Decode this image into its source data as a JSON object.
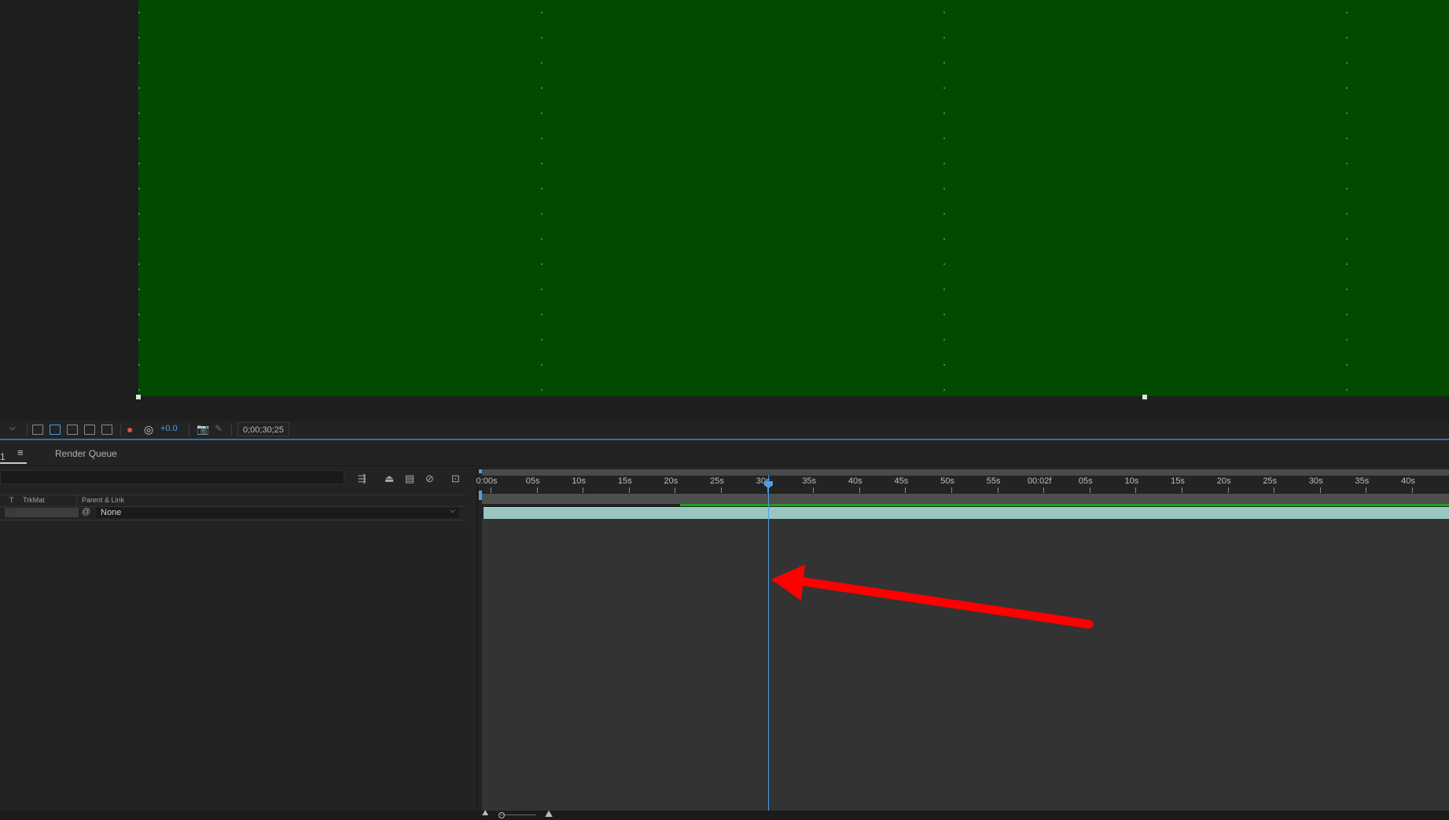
{
  "viewer": {
    "exposure_value": "+0.0",
    "current_time": "0;00;30;25"
  },
  "panel_tabs": {
    "active_tab_fragment": "1 ",
    "menu_icon": "hamburger-menu-icon",
    "render_queue_label": "Render Queue"
  },
  "timeline": {
    "columns": {
      "t": "T",
      "trkmat": "TrkMat",
      "parent_link": "Parent & Link"
    },
    "layer": {
      "parent_value": "None"
    },
    "ruler_labels": [
      "0:00s",
      "05s",
      "10s",
      "15s",
      "20s",
      "25s",
      "30s",
      "35s",
      "40s",
      "45s",
      "50s",
      "55s",
      "00:02f",
      "05s",
      "10s",
      "15s",
      "20s",
      "25s",
      "30s",
      "35s",
      "40s"
    ],
    "current_time_seconds": 30.8
  },
  "annotation": {
    "arrow_color": "#ff0000",
    "points_to": "playhead"
  },
  "colors": {
    "comp_background": "#034a01",
    "accent_blue": "#4d9fe8",
    "layer_bar": "#9ac5c0"
  }
}
